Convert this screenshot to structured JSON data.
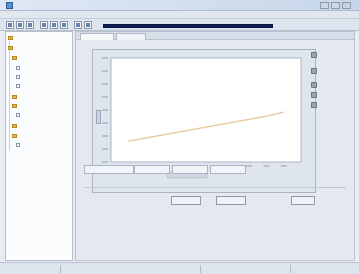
{
  "window": {
    "title": "",
    "colors": {
      "titlebar": "#c7d6ea",
      "progress": "#0d1f55",
      "line": "#e7c9a0",
      "plot_bg": "#ffffff"
    }
  },
  "menu": {
    "items": [
      "",
      "",
      "",
      "",
      "",
      "",
      ""
    ]
  },
  "toolbar": {
    "buttons": [
      "new-icon",
      "open-icon",
      "save-icon",
      "cut-icon",
      "copy-icon",
      "paste-icon",
      "print-icon",
      "help-icon"
    ]
  },
  "tree": {
    "items": [
      {
        "label": "",
        "icon": "folder-icon"
      },
      {
        "label": "",
        "icon": "folder-icon"
      },
      {
        "label": "",
        "icon": "folder-icon"
      },
      {
        "label": "",
        "icon": "file-icon"
      },
      {
        "label": "",
        "icon": "file-icon"
      },
      {
        "label": "",
        "icon": "file-icon"
      },
      {
        "label": "",
        "icon": "folder-icon"
      },
      {
        "label": "",
        "icon": "folder-icon"
      },
      {
        "label": "",
        "icon": "file-icon"
      },
      {
        "label": "",
        "icon": "folder-icon"
      },
      {
        "label": "",
        "icon": "folder-icon"
      },
      {
        "label": "",
        "icon": "file-icon"
      }
    ]
  },
  "main": {
    "tabs": [
      "",
      ""
    ],
    "buttons": {
      "apply": "",
      "reset": "",
      "ok": ""
    },
    "bottom_tabs": [
      "",
      "",
      ""
    ]
  },
  "status": {
    "segments": [
      "",
      "",
      "",
      ""
    ]
  },
  "chart_data": {
    "type": "line",
    "title": "",
    "xlabel": "",
    "ylabel": "",
    "grid": false,
    "x": [
      1,
      2,
      3,
      4,
      5,
      6,
      7,
      8,
      9,
      10
    ],
    "series": [
      {
        "values": [
          2.0,
          2.3,
          2.6,
          2.9,
          3.2,
          3.5,
          3.8,
          4.1,
          4.4,
          4.8
        ]
      }
    ],
    "xlim": [
      0,
      11
    ],
    "ylim": [
      0,
      10
    ]
  }
}
